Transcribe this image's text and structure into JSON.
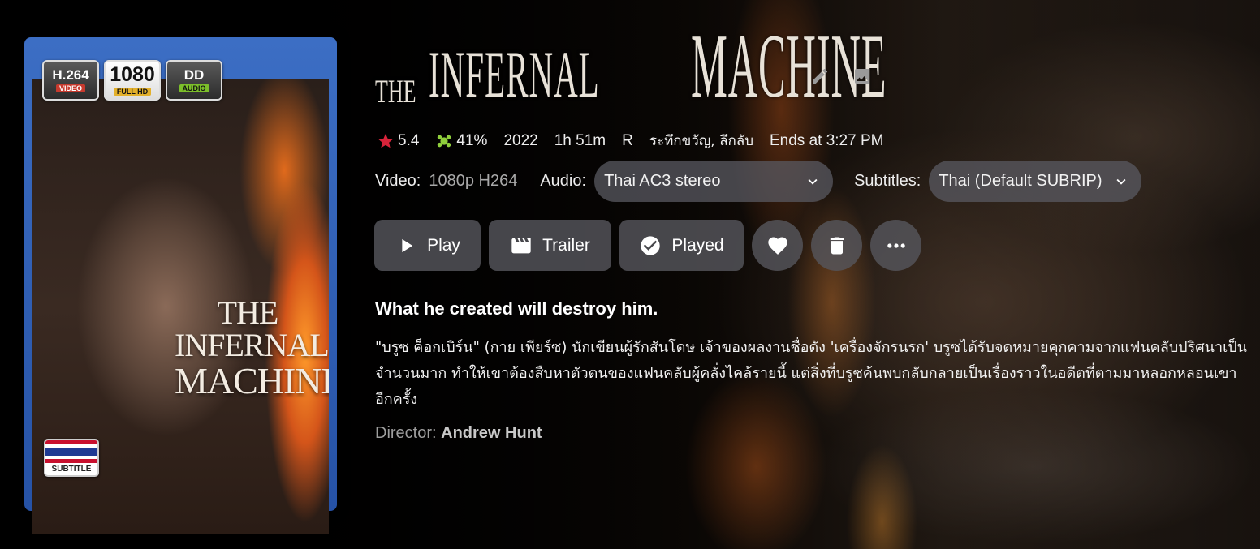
{
  "poster": {
    "badges": {
      "codec": {
        "top": "H.264",
        "bottom": "VIDEO"
      },
      "resolution": {
        "top": "1080",
        "bottom": "FULL HD"
      },
      "audio": {
        "top": "DD",
        "bottom": "AUDIO"
      }
    },
    "art_title_line1": "THE INFERNAL",
    "art_title_line2": "MACHINE",
    "subtitle_badge": "SUBTITLE"
  },
  "title": {
    "the": "THE",
    "word1": "INFERNAL",
    "word2": "MACHINE"
  },
  "meta": {
    "rating": "5.4",
    "critic": "41%",
    "year": "2022",
    "runtime": "1h 51m",
    "mpaa": "R",
    "genres": "ระทึกขวัญ, ลึกลับ",
    "ends": "Ends at 3:27 PM",
    "colors": {
      "star": "#d8233a",
      "critic": "#8fcf3c"
    }
  },
  "streams": {
    "video_label": "Video:",
    "video_value": "1080p H264",
    "audio_label": "Audio:",
    "audio_value": "Thai AC3 stereo",
    "subtitles_label": "Subtitles:",
    "subtitles_value": "Thai (Default SUBRIP)"
  },
  "actions": {
    "play": "Play",
    "trailer": "Trailer",
    "played": "Played",
    "icons": [
      "play-icon",
      "film-icon",
      "check-circle-icon",
      "heart-icon",
      "trash-icon",
      "more-icon"
    ]
  },
  "tagline": "What he created will destroy him.",
  "overview": "\"บรูซ ค็อกเบิร์น\" (กาย เพียร์ซ) นักเขียนผู้รักสันโดษ เจ้าของผลงานชื่อดัง 'เครื่องจักรนรก' บรูซได้รับจดหมายคุกคามจากแฟนคลับปริศนาเป็นจำนวนมาก ทำให้เขาต้องสืบหาตัวตนของแฟนคลับผู้คลั่งไคล้รายนี้ แต่สิ่งที่บรูซค้นพบกลับกลายเป็นเรื่องราวในอดีตที่ตามมาหลอกหลอนเขาอีกครั้ง",
  "director": {
    "label": "Director:",
    "name": "Andrew Hunt"
  }
}
